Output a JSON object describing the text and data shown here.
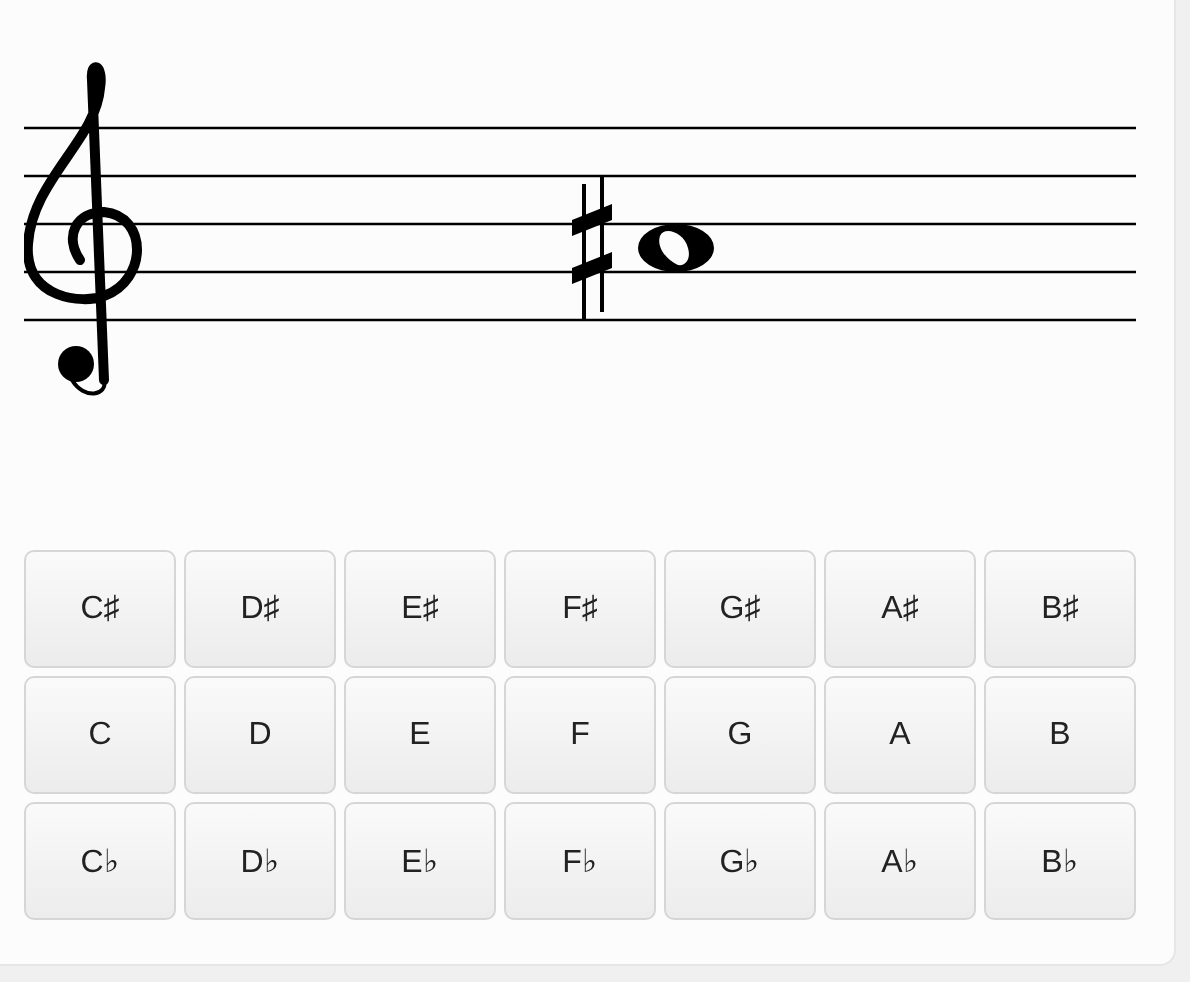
{
  "keys": [
    [
      {
        "label": "C♯"
      },
      {
        "label": "D♯"
      },
      {
        "label": "E♯"
      },
      {
        "label": "F♯"
      },
      {
        "label": "G♯"
      },
      {
        "label": "A♯"
      },
      {
        "label": "B♯"
      }
    ],
    [
      {
        "label": "C"
      },
      {
        "label": "D"
      },
      {
        "label": "E"
      },
      {
        "label": "F"
      },
      {
        "label": "G"
      },
      {
        "label": "A"
      },
      {
        "label": "B"
      }
    ],
    [
      {
        "label": "C♭"
      },
      {
        "label": "D♭"
      },
      {
        "label": "E♭"
      },
      {
        "label": "F♭"
      },
      {
        "label": "G♭"
      },
      {
        "label": "A♭"
      },
      {
        "label": "B♭"
      }
    ]
  ]
}
